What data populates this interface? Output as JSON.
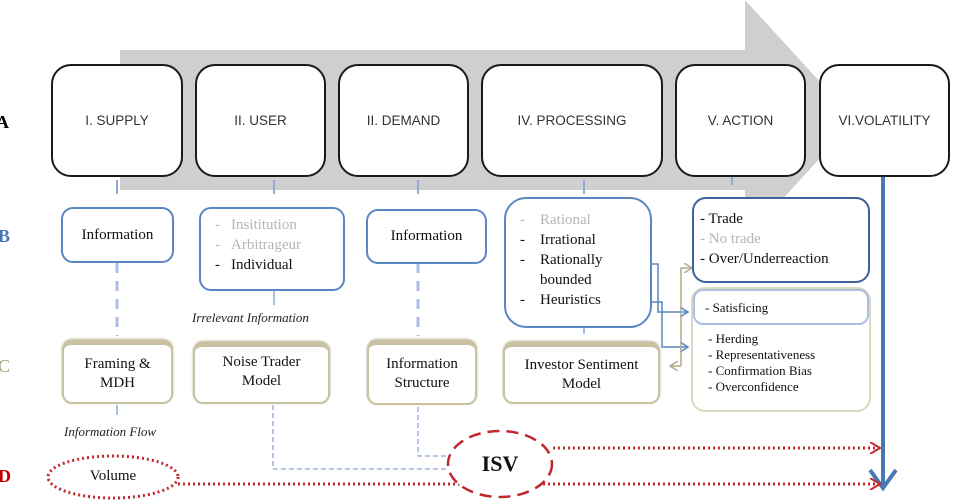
{
  "diagram": {
    "row_labels": [
      {
        "id": "A",
        "color": "#000000"
      },
      {
        "id": "B",
        "color": "#4a78b5"
      },
      {
        "id": "C",
        "color": "#a79f7a"
      },
      {
        "id": "D",
        "color": "#c00000"
      }
    ],
    "stages": [
      {
        "label": "I. SUPPLY"
      },
      {
        "label": "II. USER"
      },
      {
        "label": "II. DEMAND"
      },
      {
        "label": "IV. PROCESSING"
      },
      {
        "label": "V. ACTION"
      },
      {
        "label": "VI.VOLATILITY"
      }
    ],
    "row_b": {
      "supply": {
        "label": "Information"
      },
      "user": {
        "items": [
          {
            "text": "Insititution",
            "active": false
          },
          {
            "text": "Arbitrageur",
            "active": false
          },
          {
            "text": "Individual",
            "active": true
          }
        ]
      },
      "demand": {
        "label": "Information"
      },
      "processing": {
        "items": [
          {
            "text": "Rational",
            "active": false
          },
          {
            "text": "Irrational",
            "active": true
          },
          {
            "text": "Rationally",
            "active": true
          },
          {
            "text": "bounded",
            "active": true
          },
          {
            "text": "Heuristics",
            "active": true
          }
        ]
      },
      "action": {
        "items": [
          {
            "text": "- Trade",
            "active": true
          },
          {
            "text": "- No trade",
            "active": false
          },
          {
            "text": "- Over/Underreaction",
            "active": true
          }
        ]
      },
      "satisficing": {
        "label": "- Satisficing"
      },
      "biases": [
        "- Herding",
        "- Representativeness",
        "- Confirmation  Bias",
        "- Overconfidence"
      ]
    },
    "annotations": {
      "irrelevant_information": "Irrelevant Information",
      "information_flow": "Information Flow"
    },
    "row_c": [
      {
        "line1": "Framing &",
        "line2": "MDH"
      },
      {
        "line1": "Noise Trader",
        "line2": "Model"
      },
      {
        "line1": "Information",
        "line2": "Structure"
      },
      {
        "line1": "Investor Sentiment",
        "line2": "Model"
      }
    ],
    "row_d": {
      "volume": "Volume",
      "isv": "ISV"
    },
    "colors": {
      "arrow_fill": "#cfcfcf",
      "stage_border": "#1a1a1a",
      "blue_border": "#5a86c2",
      "tan_border": "#c8c2a2",
      "red_dotted": "#c0282d",
      "volatility_arrow": "#4a78b5"
    }
  }
}
